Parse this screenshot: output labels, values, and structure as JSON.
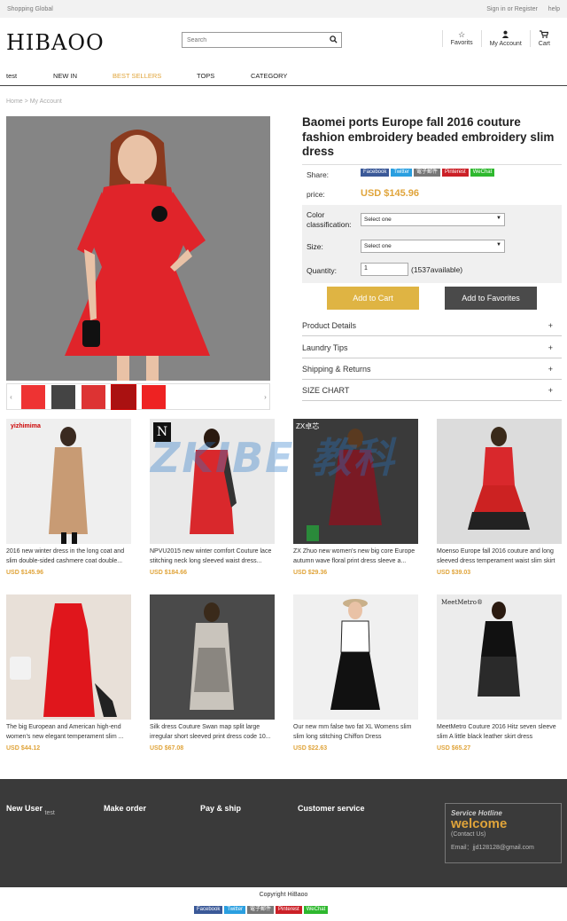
{
  "topbar": {
    "left": "Shopping Global",
    "signin": "Sign in or Register",
    "help": "help"
  },
  "header": {
    "logo": "HIBAOO",
    "search_placeholder": "Search",
    "favorites": "Favorits",
    "account": "My Account",
    "cart": "Cart"
  },
  "nav": {
    "items": [
      "test",
      "NEW IN",
      "BEST SELLERS",
      "TOPS",
      "CATEGORY"
    ],
    "active_color": "#e0a43a"
  },
  "breadcrumb": {
    "home": "Home",
    "sep": ">",
    "current": "My Account"
  },
  "product": {
    "title": "Baomei ports Europe fall 2016 couture fashion embroidery beaded embroidery slim dress",
    "share_label": "Share:",
    "share_buttons": [
      "Facebook",
      "Twitter",
      "電子郵件",
      "Pinterest",
      "WeChat"
    ],
    "price_label": "price:",
    "price": "USD $145.96",
    "color_label": "Color classification:",
    "color_value": "Select one",
    "size_label": "Size:",
    "size_value": "Select one",
    "qty_label": "Quantity:",
    "qty_value": "1",
    "available": "(1537available)",
    "add_cart": "Add to Cart",
    "add_fav": "Add to Favorites",
    "accordion": [
      "Product Details",
      "Laundry Tips",
      "Shipping & Returns",
      "SIZE CHART"
    ],
    "plus": "+"
  },
  "products": [
    {
      "name": "2016 new winter dress in the long coat and slim double-sided cashmere coat double...",
      "price": "USD $145.96",
      "brand": "yizhimima"
    },
    {
      "name": "NPVU2015 new winter comfort Couture lace stitching neck long sleeved waist dress...",
      "price": "USD $184.66",
      "brand": "N"
    },
    {
      "name": "ZX Zhuo new women's new big core Europe autumn wave floral print dress sleeve a...",
      "price": "USD $29.36",
      "brand": "ZX卓芯"
    },
    {
      "name": "Moenso Europe fall 2016 couture and long sleeved dress temperament waist slim skirt",
      "price": "USD $39.03",
      "brand": ""
    },
    {
      "name": "The big European and American high-end women's new elegant temperament slim ...",
      "price": "USD $44.12",
      "brand": ""
    },
    {
      "name": "Silk dress Couture Swan map split large irregular short sleeved print dress code 10...",
      "price": "USD $67.08",
      "brand": ""
    },
    {
      "name": "Our new mm false two fat XL Womens slim slim long stitching Chiffon Dress",
      "price": "USD $22.63",
      "brand": ""
    },
    {
      "name": "MeetMetro Couture 2016 Hitz seven sleeve slim A little black leather skirt dress",
      "price": "USD $65.27",
      "brand": "MeetMetro®"
    }
  ],
  "watermark": "ZKIBE 教科",
  "footer": {
    "new_user": "New User",
    "new_user_sub": "test",
    "make_order": "Make order",
    "pay_ship": "Pay & ship",
    "customer_service": "Customer service",
    "hotline": "Service Hotline",
    "welcome": "welcome",
    "contact": "(Contact Us)",
    "email": "Email：jjd128128@gmail.com",
    "copyright": "Copyright HiBaoo"
  }
}
